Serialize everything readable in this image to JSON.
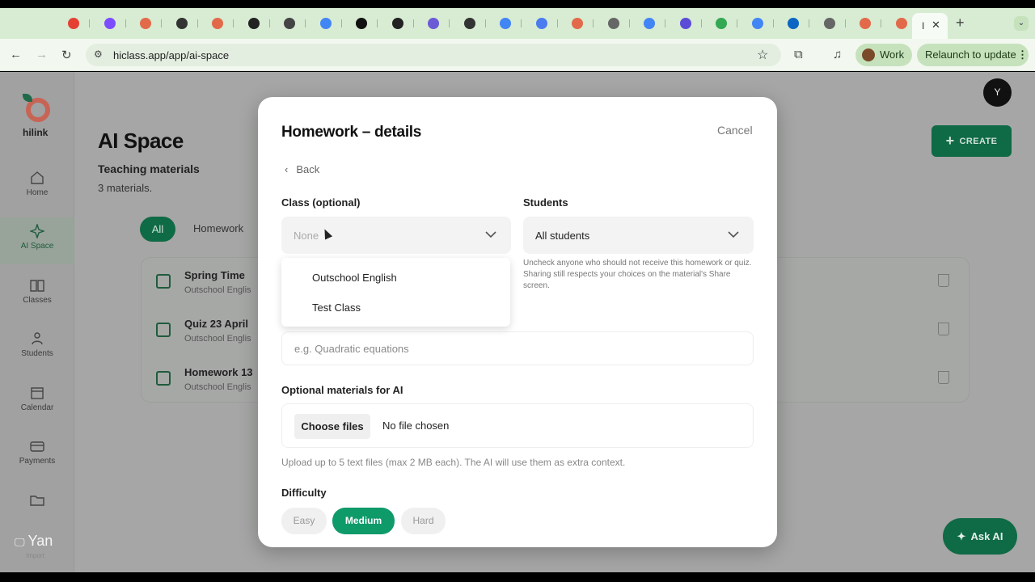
{
  "browser": {
    "url": "hiclass.app/app/ai-space",
    "profile_label": "Work",
    "relaunch_label": "Relaunch to update",
    "tab_colors": [
      "#e44134",
      "#7c4dff",
      "#e26a4a",
      "#333333",
      "#e26a4a",
      "#222222",
      "#444444",
      "#4285f4",
      "#111111",
      "#222222",
      "#6b5bd6",
      "#333333",
      "#4285f4",
      "#4a7cf0",
      "#e26a4a",
      "#666666",
      "#4285f4",
      "#5b4bd6",
      "#34a853",
      "#4285f4",
      "#0a66c2",
      "#666666",
      "#e26a4a",
      "#e26a4a"
    ]
  },
  "sidebar": {
    "logo_text": "hilink",
    "items": [
      {
        "label": "Home",
        "icon": "home-icon"
      },
      {
        "label": "AI Space",
        "icon": "sparkle-icon"
      },
      {
        "label": "Classes",
        "icon": "book-icon"
      },
      {
        "label": "Students",
        "icon": "users-icon"
      },
      {
        "label": "Calendar",
        "icon": "calendar-icon"
      },
      {
        "label": "Payments",
        "icon": "card-icon"
      },
      {
        "label": "",
        "icon": "folder-icon"
      }
    ]
  },
  "page": {
    "title": "AI Space",
    "subtitle": "Teaching materials",
    "count": "3 materials.",
    "filters": [
      "All",
      "Homework"
    ],
    "create_label": "CREATE",
    "avatar_initial": "Y",
    "ask_ai_label": "Ask AI",
    "materials": [
      {
        "title": "Spring Time",
        "sub": "Outschool Englis"
      },
      {
        "title": "Quiz 23 April",
        "sub": "Outschool Englis"
      },
      {
        "title": "Homework 13",
        "sub": "Outschool Englis"
      }
    ]
  },
  "modal": {
    "title": "Homework – details",
    "cancel_label": "Cancel",
    "back_label": "Back",
    "class_label": "Class (optional)",
    "class_value": "None",
    "class_options": [
      "Outschool English",
      "Test Class"
    ],
    "students_label": "Students",
    "students_value": "All students",
    "students_help": "Uncheck anyone who should not receive this homework or quiz. Sharing still respects your choices on the material's Share screen.",
    "topic_placeholder": "e.g. Quadratic equations",
    "materials_label": "Optional materials for AI",
    "choose_files_label": "Choose files",
    "no_file_label": "No file chosen",
    "upload_help": "Upload up to 5 text files (max 2 MB each). The AI will use them as extra context.",
    "difficulty_label": "Difficulty",
    "difficulty_options": [
      "Easy",
      "Medium",
      "Hard"
    ],
    "difficulty_selected": "Medium"
  },
  "presenter": {
    "name": "Yan",
    "sub": "Import"
  }
}
